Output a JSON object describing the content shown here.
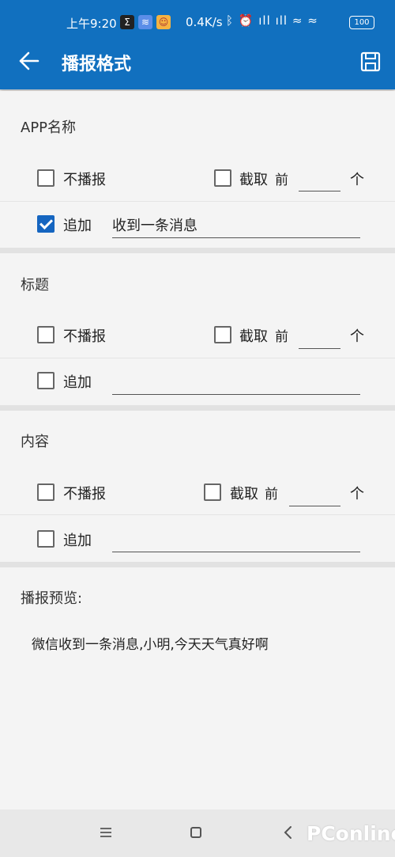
{
  "status_bar": {
    "time": "上午9:20",
    "net_speed": "0.4K/s",
    "battery": "100",
    "icons": [
      "sigma-icon",
      "voice-icon",
      "avatar-icon",
      "bluetooth-icon",
      "alarm-icon",
      "signal-hd-icon",
      "signal-hd-icon",
      "wifi-icon",
      "wifi-icon",
      "battery-icon"
    ]
  },
  "header": {
    "title": "播报格式",
    "accent": "#1170bf"
  },
  "sections": [
    {
      "title": "APP名称",
      "no_broadcast": {
        "label": "不播报",
        "checked": false
      },
      "truncate": {
        "label": "截取",
        "prefix": "前",
        "value": "",
        "suffix": "个",
        "checked": false
      },
      "append": {
        "label": "追加",
        "value": "收到一条消息",
        "checked": true
      }
    },
    {
      "title": "标题",
      "no_broadcast": {
        "label": "不播报",
        "checked": false
      },
      "truncate": {
        "label": "截取",
        "prefix": "前",
        "value": "",
        "suffix": "个",
        "checked": false
      },
      "append": {
        "label": "追加",
        "value": "",
        "checked": false
      }
    },
    {
      "title": "内容",
      "no_broadcast": {
        "label": "不播报",
        "checked": false
      },
      "truncate": {
        "label": "截取",
        "prefix": "前",
        "value": "",
        "suffix": "个",
        "checked": false
      },
      "append": {
        "label": "追加",
        "value": "",
        "checked": false
      }
    }
  ],
  "preview": {
    "label": "播报预览:",
    "text": "微信收到一条消息,小明,今天天气真好啊"
  },
  "watermark": "PConline"
}
